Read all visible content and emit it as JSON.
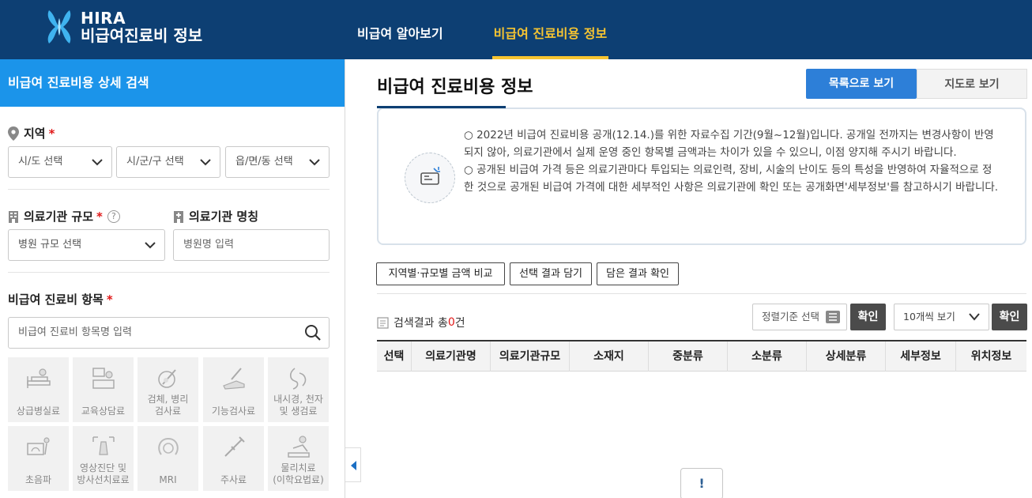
{
  "header": {
    "logo_line1": "HIRA",
    "logo_line2": "비급여진료비 정보",
    "nav": [
      {
        "label": "비급여 알아보기",
        "active": false
      },
      {
        "label": "비급여 진료비용 정보",
        "active": true
      }
    ]
  },
  "search_panel": {
    "title": "비급여 진료비용 상세 검색",
    "region": {
      "label": "지역",
      "required_mark": "*",
      "selects": [
        "시/도 선택",
        "시/군/구 선택",
        "읍/면/동 선택"
      ]
    },
    "scale": {
      "label": "의료기관 규모",
      "required_mark": "*",
      "help_icon": "?",
      "select": "병원 규모 선택"
    },
    "name": {
      "label": "의료기관 명칭",
      "placeholder": "병원명 입력"
    },
    "item": {
      "label": "비급여 진료비 항목",
      "required_mark": "*",
      "placeholder": "비급여 진료비 항목명 입력"
    },
    "categories": [
      {
        "label": "상급병실료",
        "icon": "hospital-bed-icon"
      },
      {
        "label": "교육상담료",
        "icon": "consultation-icon"
      },
      {
        "label": "검체, 병리\n검사료",
        "icon": "specimen-icon"
      },
      {
        "label": "기능검사료",
        "icon": "function-test-icon"
      },
      {
        "label": "내시경, 천자\n및 생검료",
        "icon": "endoscopy-icon"
      },
      {
        "label": "초음파",
        "icon": "ultrasound-icon"
      },
      {
        "label": "영상진단 및\n방사선치료료",
        "icon": "radiology-icon"
      },
      {
        "label": "MRI",
        "icon": "mri-icon"
      },
      {
        "label": "주사료",
        "icon": "injection-icon"
      },
      {
        "label": "물리치료\n(이학요법료)",
        "icon": "physical-therapy-icon"
      }
    ]
  },
  "main": {
    "title": "비급여 진료비용 정보",
    "view_list": "목록으로 보기",
    "view_map": "지도로 보기",
    "notice_lines": [
      "○ 2022년 비급여 진료비용 공개(12.14.)를 위한 자료수집 기간(9월~12월)입니다. 공개일 전까지는 변경사항이 반영되지 않아, 의료기관에서 실제 운영 중인 항목별 금액과는 차이가 있을 수 있으니, 이점 양지해 주시기 바랍니다.",
      "○ 공개된 비급여 가격 등은 의료기관마다 투입되는 의료인력, 장비, 시술의 난이도 등의 특성을 반영하여 자율적으로 정한 것으로 공개된 비급여 가격에 대한 세부적인 사항은 의료기관에 확인 또는 공개화면'세부정보'를 참고하시기 바랍니다."
    ],
    "actions": [
      "지역별·규모별 금액 비교",
      "선택 결과 담기",
      "담은 결과 확인"
    ],
    "result_prefix": "검색결과 총",
    "result_count": "0",
    "result_suffix": "건",
    "sort_label": "정렬기준 선택",
    "confirm": "확인",
    "per_page": "10개씩 보기",
    "columns": [
      "선택",
      "의료기관명",
      "의료기관규모",
      "소재지",
      "중분류",
      "소분류",
      "상세분류",
      "세부정보",
      "위치정보"
    ],
    "empty_alert": "!"
  },
  "colors": {
    "header_bg": "#0d3f73",
    "nav_active": "#f7c531",
    "panel_head": "#1b94ea",
    "primary_button": "#2d7fd8",
    "required": "#e01818"
  }
}
